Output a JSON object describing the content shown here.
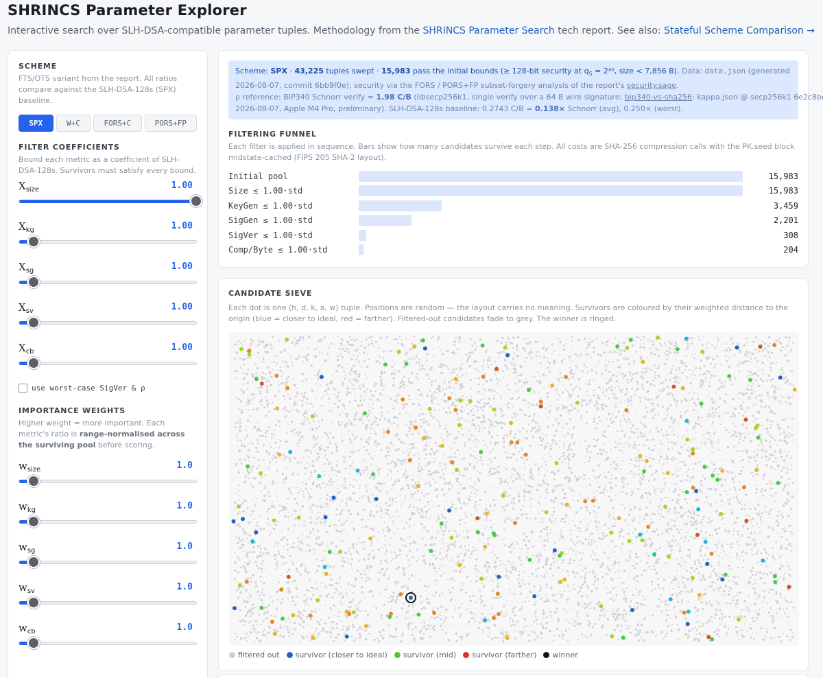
{
  "header": {
    "title": "SHRINCS Parameter Explorer",
    "subtitle_pre": "Interactive search over SLH-DSA-compatible parameter tuples. Methodology from the",
    "tech_report_link": "SHRINCS Parameter Search",
    "subtitle_mid": "tech report. See also:",
    "comparison_link": "Stateful Scheme Comparison →"
  },
  "sidebar": {
    "scheme": {
      "heading": "SCHEME",
      "description": "FTS/OTS variant from the report. All ratios compare against the SLH-DSA-128s (SPX) baseline.",
      "buttons": [
        "SPX",
        "W+C",
        "FORS+C",
        "PORS+FP"
      ],
      "active": "SPX"
    },
    "filters": {
      "heading": "FILTER COEFFICIENTS",
      "description": "Bound each metric as a coefficient of SLH-DSA-128s. Survivors must satisfy every bound.",
      "sliders": [
        {
          "sym": "X",
          "sub": "size",
          "value": "1.00",
          "level": 1.0
        },
        {
          "sym": "X",
          "sub": "kg",
          "value": "1.00",
          "level": 0.0
        },
        {
          "sym": "X",
          "sub": "sg",
          "value": "1.00",
          "level": 0.0
        },
        {
          "sym": "X",
          "sub": "sv",
          "value": "1.00",
          "level": 0.0
        },
        {
          "sym": "X",
          "sub": "cb",
          "value": "1.00",
          "level": 0.0
        }
      ],
      "worst_case_label": "use worst-case SigVer & ρ"
    },
    "weights": {
      "heading": "IMPORTANCE WEIGHTS",
      "description_pre": "Higher weight = more important. Each metric's ratio is",
      "description_bold": "range-normalised across the surviving pool",
      "description_post": "before scoring.",
      "sliders": [
        {
          "sym": "w",
          "sub": "size",
          "value": "1.0",
          "level": 0.0
        },
        {
          "sym": "w",
          "sub": "kg",
          "value": "1.0",
          "level": 0.0
        },
        {
          "sym": "w",
          "sub": "sg",
          "value": "1.0",
          "level": 0.0
        },
        {
          "sym": "w",
          "sub": "sv",
          "value": "1.0",
          "level": 0.0
        },
        {
          "sym": "w",
          "sub": "cb",
          "value": "1.0",
          "level": 0.0
        }
      ]
    }
  },
  "summary": {
    "l1_a": "Scheme:",
    "l1_scheme": "SPX",
    "l1_b": "·",
    "l1_tuples": "43,225",
    "l1_c": "tuples swept ·",
    "l1_pass": "15,983",
    "l1_d": "pass the initial bounds (≥ 128-bit security at q",
    "l1_qsub": "S",
    "l1_e": " = 2⁴⁰, size < 7,856 B).",
    "l1_f": "Data:",
    "l1_file": "data.json",
    "l1_g": "(generated",
    "l2": "2026-08-07, commit 6bb9f0e); security via the FORS / PORS+FP subset-forgery analysis of the report's",
    "l2_link": "security.sage",
    "l2_end": ".",
    "l3_a": "ρ reference: BIP340 Schnorr verify ≈",
    "l3_val": "1.98 C/B",
    "l3_b": "(libsecp256k1, single verify over a 64 B wire signature;",
    "l3_link": "bip340-vs-sha256",
    "l3_c": ": kappa.json @ secp256k1 6e2c8bc,",
    "l4_a": "2026-08-07, Apple M4 Pro, preliminary). SLH-DSA-128s baseline: 0.2743 C/B =",
    "l4_val": "0.138×",
    "l4_b": "Schnorr (avg), 0.250× (worst)."
  },
  "funnel": {
    "heading": "FILTERING FUNNEL",
    "description": "Each filter is applied in sequence. Bars show how many candidates survive each step. All costs are SHA-256 compression calls with the PK.seed block midstate-cached (FIPS 205 SHA-2 layout).",
    "rows": [
      {
        "label": "Initial pool",
        "count": "15,983",
        "value": 15983
      },
      {
        "label": "Size ≤ 1.00·std",
        "count": "15,983",
        "value": 15983
      },
      {
        "label": "KeyGen ≤ 1.00·std",
        "count": "3,459",
        "value": 3459
      },
      {
        "label": "SigGen ≤ 1.00·std",
        "count": "2,201",
        "value": 2201
      },
      {
        "label": "SigVer ≤ 1.00·std",
        "count": "308",
        "value": 308
      },
      {
        "label": "Comp/Byte ≤ 1.00·std",
        "count": "204",
        "value": 204
      }
    ]
  },
  "sieve": {
    "heading": "CANDIDATE SIEVE",
    "description": "Each dot is one (h, d, k, a, w) tuple. Positions are random — the layout carries no meaning. Survivors are coloured by their weighted distance to the origin (blue = closer to ideal, red = farther). Filtered-out candidates fade to grey. The winner is ringed.",
    "legend": [
      {
        "label": "filtered out",
        "color": "#cfcfd2"
      },
      {
        "label": "survivor (closer to ideal)",
        "color": "#2a5fc4"
      },
      {
        "label": "survivor (mid)",
        "color": "#56c23a"
      },
      {
        "label": "survivor (farther)",
        "color": "#d63030"
      },
      {
        "label": "winner",
        "color": "#111111"
      }
    ],
    "palette": [
      "#2a5fc4",
      "#22b5d9",
      "#1fc9a8",
      "#4cc84a",
      "#a8d42a",
      "#e3b72a",
      "#e08a2a",
      "#d3542a"
    ]
  }
}
